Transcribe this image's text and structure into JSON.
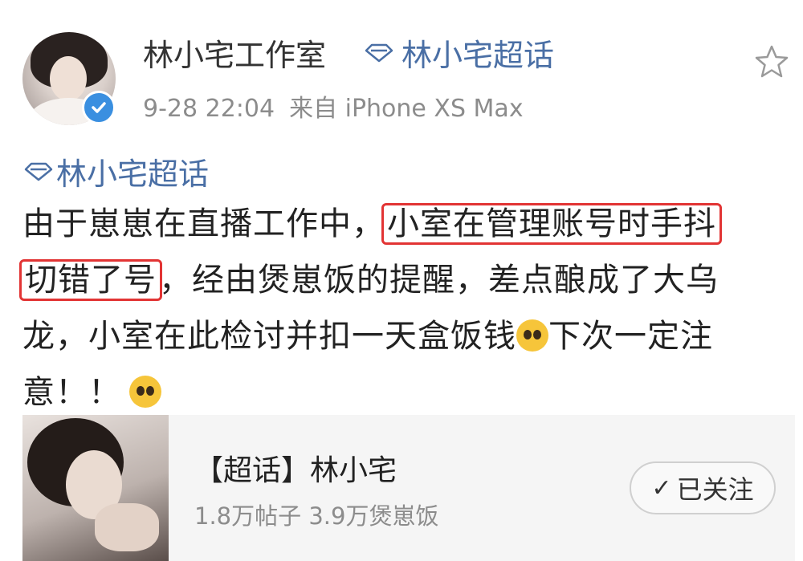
{
  "post": {
    "author": "林小宅工作室",
    "topic_link": "林小宅超话",
    "time": "9-28 22:04",
    "source": "来自 iPhone XS Max",
    "body_topic": "林小宅超话",
    "lines": [
      [
        "由于崽崽在直播工作中，",
        "小室在管理账号时手抖"
      ],
      [
        "切错了号",
        "，经由煲崽饭的提醒，差点酿成了大乌"
      ],
      [
        "龙，小室在此检讨并扣一天盒饭钱",
        "下次一定注"
      ],
      [
        "意！！"
      ]
    ]
  },
  "card": {
    "title": "【超话】林小宅",
    "stats": "1.8万帖子 3.9万煲崽饭",
    "follow_label": "已关注",
    "follow_check": "✓"
  },
  "icons": {
    "verified": "verified-badge-icon",
    "topic": "diamond-icon",
    "favorite": "star-icon",
    "emoji": "pleading-face-emoji"
  },
  "colors": {
    "link": "#4a6fa5",
    "highlight_box": "#e23434",
    "verified": "#3a8fe0"
  }
}
